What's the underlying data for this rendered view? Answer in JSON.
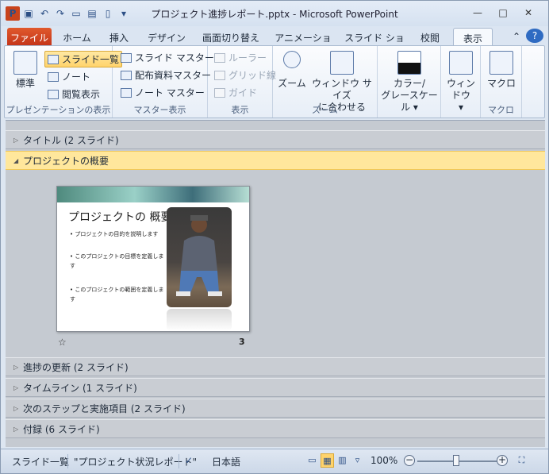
{
  "window": {
    "title": "プロジェクト進捗レポート.pptx  -  Microsoft PowerPoint",
    "min": "—",
    "max": "□",
    "close": "✕"
  },
  "tabs": [
    "ファイル",
    "ホーム",
    "挿入",
    "デザイン",
    "画面切り替え",
    "アニメーション",
    "スライド ショー",
    "校閲",
    "表示"
  ],
  "ribbon": {
    "presentation": {
      "normal": "標準",
      "sorter": "スライド一覧",
      "notes": "ノート",
      "reading": "閲覧表示",
      "label": "プレゼンテーションの表示"
    },
    "master": {
      "slide_master": "スライド マスター",
      "handout_master": "配布資料マスター",
      "notes_master": "ノート マスター",
      "label": "マスター表示"
    },
    "show": {
      "ruler": "ルーラー",
      "gridlines": "グリッド線",
      "guides": "ガイド",
      "label": "表示"
    },
    "zoom": {
      "zoom": "ズーム",
      "fit1": "ウィンドウ サイズ",
      "fit2": "に合わせる",
      "label": "ズーム"
    },
    "color": {
      "line1": "カラー/",
      "line2": "グレースケール ▾"
    },
    "window": {
      "label": "ウィンドウ",
      "arrow": "▾"
    },
    "macro": {
      "macro": "マクロ",
      "label": "マクロ"
    }
  },
  "sections": [
    {
      "name": "タイトル (2 スライド)",
      "tri": "▷"
    },
    {
      "name": "プロジェクトの概要",
      "tri": "◢"
    },
    {
      "name": "進捗の更新 (2 スライド)",
      "tri": "▷"
    },
    {
      "name": "タイムライン (1 スライド)",
      "tri": "▷"
    },
    {
      "name": "次のステップと実施項目 (2 スライド)",
      "tri": "▷"
    },
    {
      "name": "付録 (6 スライド)",
      "tri": "▷"
    }
  ],
  "slide": {
    "title": "プロジェクトの 概要",
    "bullets": [
      "• プロジェクトの目的を説明します",
      "• このプロジェクトの目標を定義します",
      "• このプロジェクトの範囲を定義します"
    ],
    "number": "3",
    "star": "☆"
  },
  "status": {
    "view": "スライド一覧",
    "theme": "\"プロジェクト状況レポート\"",
    "lang": "日本語",
    "zoom": "100%"
  }
}
